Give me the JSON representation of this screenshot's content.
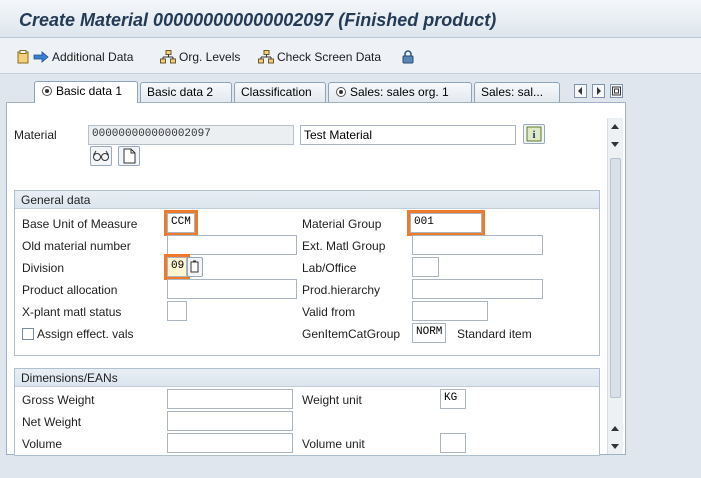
{
  "window": {
    "title": "Create Material 000000000000002097 (Finished product)"
  },
  "toolbar": {
    "additional_data": "Additional Data",
    "org_levels": "Org. Levels",
    "check_screen_data": "Check Screen Data"
  },
  "tabs": [
    {
      "label": "Basic data 1",
      "active": true
    },
    {
      "label": "Basic data 2",
      "active": false
    },
    {
      "label": "Classification",
      "active": false
    },
    {
      "label": "Sales: sales org. 1",
      "active": false
    },
    {
      "label": "Sales: sal...",
      "active": false
    }
  ],
  "header": {
    "material_label": "Material",
    "material_number": "000000000000002097",
    "material_description": "Test Material"
  },
  "general_data": {
    "title": "General data",
    "base_uom_label": "Base Unit of Measure",
    "base_uom_value": "CCM",
    "material_group_label": "Material Group",
    "material_group_value": "001",
    "old_material_number_label": "Old material number",
    "old_material_number_value": "",
    "ext_matl_group_label": "Ext. Matl Group",
    "ext_matl_group_value": "",
    "division_label": "Division",
    "division_value": "09",
    "lab_office_label": "Lab/Office",
    "lab_office_value": "",
    "product_allocation_label": "Product allocation",
    "product_allocation_value": "",
    "prod_hierarchy_label": "Prod.hierarchy",
    "prod_hierarchy_value": "",
    "xplant_status_label": "X-plant matl status",
    "xplant_status_value": "",
    "valid_from_label": "Valid from",
    "valid_from_value": "",
    "assign_effect_label": "Assign effect. vals",
    "gen_item_cat_label": "GenItemCatGroup",
    "gen_item_cat_value": "NORM",
    "gen_item_cat_desc": "Standard item"
  },
  "dimensions": {
    "title": "Dimensions/EANs",
    "gross_weight_label": "Gross Weight",
    "gross_weight_value": "",
    "weight_unit_label": "Weight unit",
    "weight_unit_value": "KG",
    "net_weight_label": "Net Weight",
    "net_weight_value": "",
    "volume_label": "Volume",
    "volume_value": "",
    "volume_unit_label": "Volume unit",
    "volume_unit_value": ""
  },
  "colors": {
    "highlight": "#f07a2c",
    "title_text": "#243a55"
  }
}
